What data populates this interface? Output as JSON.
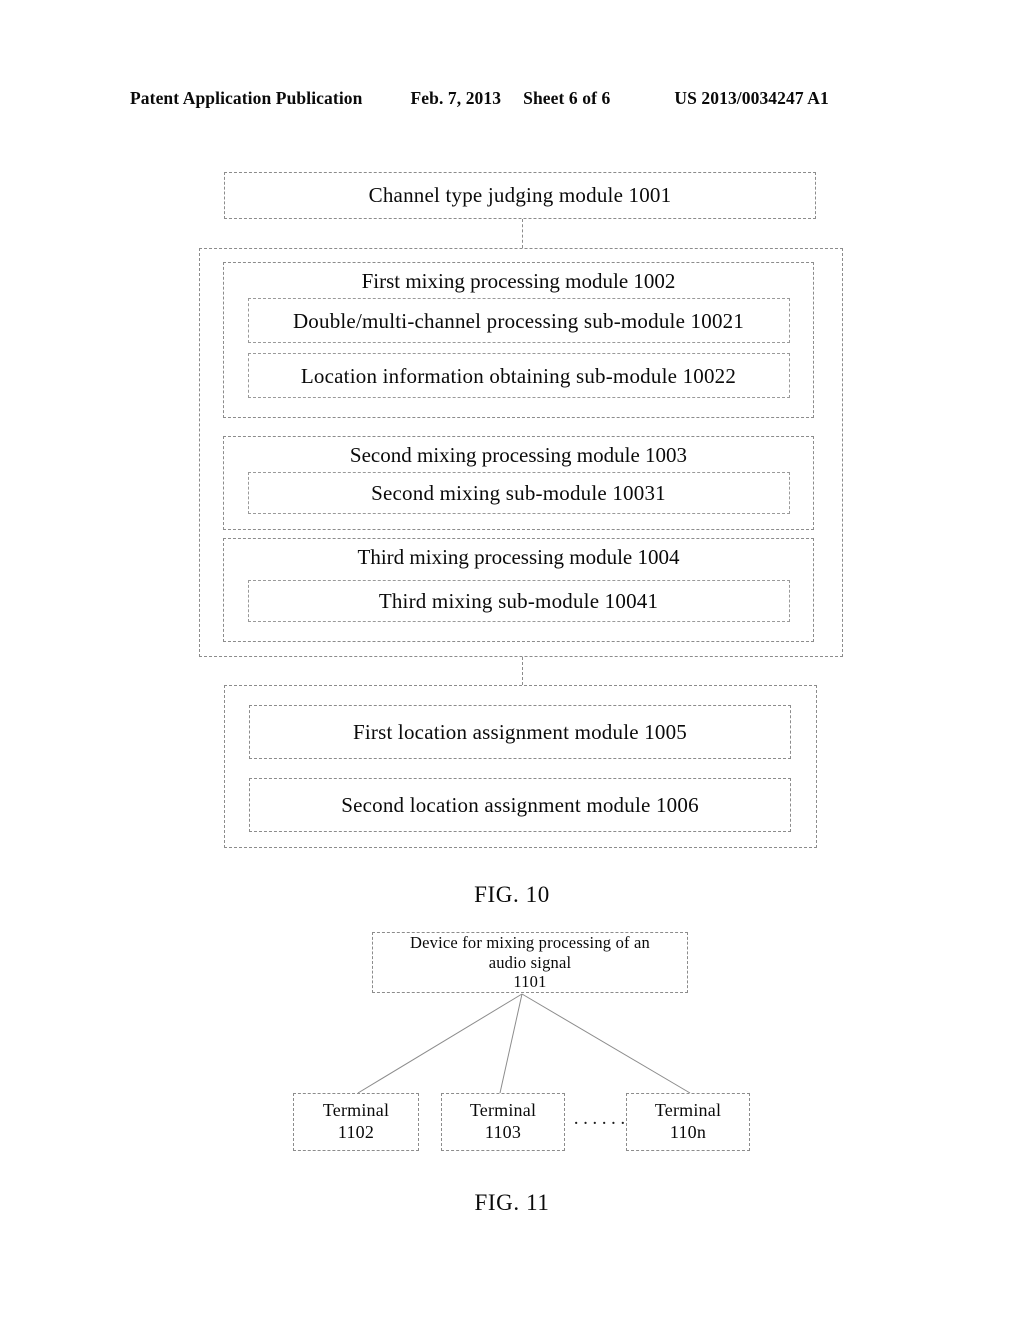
{
  "header": {
    "publication": "Patent Application Publication",
    "date": "Feb. 7, 2013",
    "sheet": "Sheet 6 of 6",
    "publication_number": "US 2013/0034247 A1"
  },
  "figures": [
    {
      "caption": "FIG. 10",
      "top_box": "Channel type judging module 1001",
      "modules": [
        {
          "title": "First mixing processing module 1002",
          "submodules": [
            "Double/multi-channel processing sub-module 10021",
            "Location information obtaining sub-module 10022"
          ]
        },
        {
          "title": "Second mixing processing module 1003",
          "submodules": [
            "Second mixing sub-module 10031"
          ]
        },
        {
          "title": "Third mixing processing module 1004",
          "submodules": [
            "Third mixing sub-module 10041"
          ]
        }
      ],
      "bottom_group": [
        "First location assignment module 1005",
        "Second location assignment module 1006"
      ]
    },
    {
      "caption": "FIG. 11",
      "device_box": "Device for mixing processing of an\naudio signal\n1101",
      "terminals": [
        "Terminal\n1102",
        "Terminal\n1103",
        "Terminal\n110n"
      ],
      "ellipsis": "······"
    }
  ],
  "colors": {
    "line": "#8c8c8c",
    "text": "#0a0a0a",
    "background": "#ffffff"
  }
}
